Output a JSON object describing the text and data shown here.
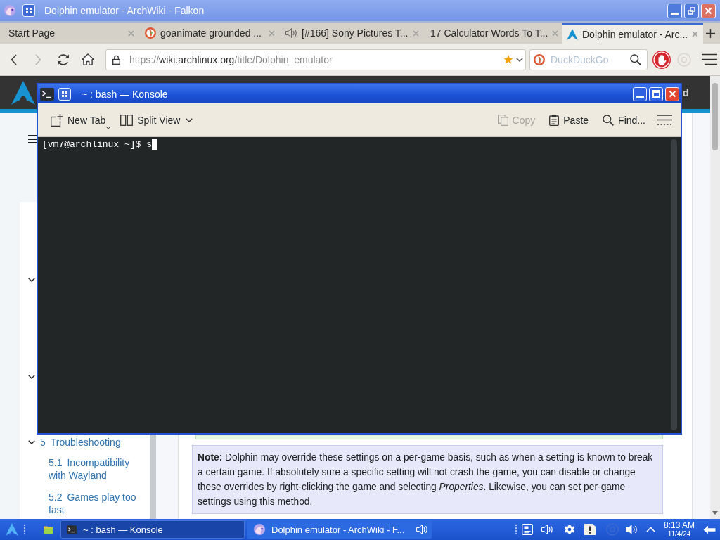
{
  "browser": {
    "title": "Dolphin emulator - ArchWiki - Falkon",
    "active": false
  },
  "tabs": [
    {
      "title": "Start Page",
      "kind": "plain",
      "selected": false
    },
    {
      "title": "goanimate grounded ...",
      "kind": "search",
      "selected": false
    },
    {
      "title": "[#166] Sony Pictures T...",
      "kind": "audio",
      "selected": false
    },
    {
      "title": "17 Calculator Words To T...",
      "kind": "plain",
      "selected": false
    },
    {
      "title": "Dolphin emulator - Arc...",
      "kind": "wiki",
      "selected": true
    }
  ],
  "navigation": {
    "buttons": [
      {
        "kind": "back",
        "disabled": false
      },
      {
        "kind": "forward",
        "disabled": true
      },
      {
        "kind": "reload",
        "disabled": false
      },
      {
        "kind": "home",
        "disabled": false
      }
    ],
    "url": {
      "scheme": "https://",
      "host": "wiki.archlinux.org",
      "path": "/title/Dolphin_emulator"
    },
    "bookmarked": true,
    "search": {
      "placeholder": "DuckDuckGo"
    }
  },
  "page": {
    "header_text": "d",
    "toc": [
      {
        "expanded": true
      },
      {
        "expanded": true
      },
      {
        "number": "5",
        "title": "Troubleshooting",
        "expanded": true,
        "children": [
          {
            "number": "5.1",
            "title": "Incompatibility with Wayland"
          },
          {
            "number": "5.2",
            "title": "Games play too fast"
          }
        ]
      }
    ],
    "note": "**Note:** Dolphin may override these settings on a per-game basis, such as when a setting is known to break a certain game. If absolutely sure a specific setting will not crash the game, you can disable or change these overrides by right-clicking the game and selecting *Properties*. Likewise, you can set per-game settings using this method."
  },
  "konsole": {
    "title": "~ : bash — Konsole",
    "active": true,
    "toolbar": [
      {
        "label": "New Tab",
        "kind": "new-tab",
        "disabled": false
      },
      {
        "label": "Split View",
        "kind": "split",
        "disabled": false
      },
      {
        "label": "Copy",
        "kind": "copy",
        "disabled": true
      },
      {
        "label": "Paste",
        "kind": "paste",
        "disabled": false
      },
      {
        "label": "Find...",
        "kind": "find",
        "disabled": false
      }
    ],
    "prompt": "[vm7@archlinux ~]$ s"
  },
  "taskbar": {
    "tasks": [
      {
        "title": "~ : bash — Konsole",
        "kind": "terminal",
        "selected": true,
        "audio": false
      },
      {
        "title": "Dolphin emulator - ArchWiki - F...",
        "kind": "browser",
        "selected": false,
        "audio": true
      }
    ],
    "clock": {
      "time": "8:13 AM",
      "date": "11/4/24"
    }
  }
}
